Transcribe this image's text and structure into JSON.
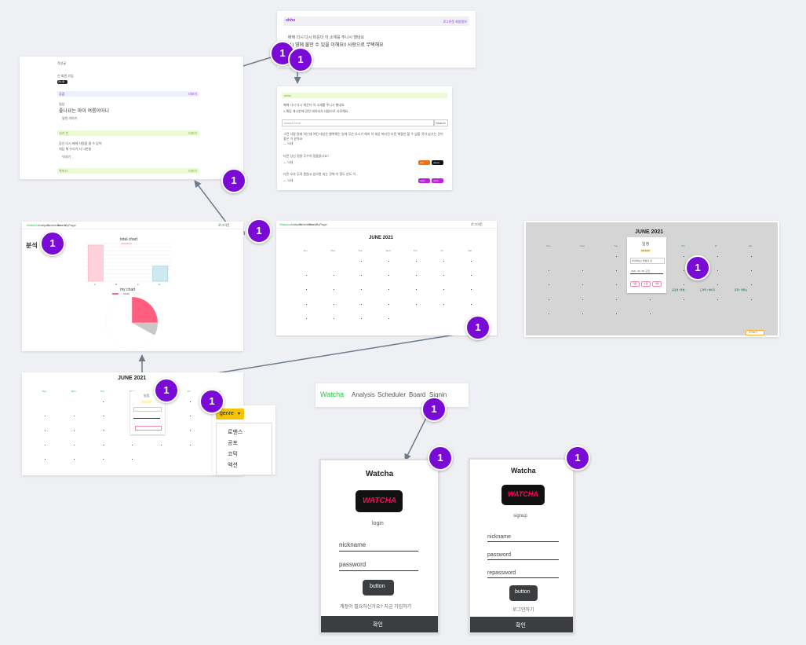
{
  "board_search": {
    "logo": "ohho",
    "top_right": "로그아웃 회원정보",
    "desc": "배에 다시 다시 파운더 이 소재를 주니시 했네요",
    "headline": "(1) 영에 불만 수 있을 이해요!! 사랑으로 무택해요"
  },
  "posts_card": {
    "header_link": "게시물",
    "tag": "ohho",
    "intro": "배에 다시 다시 파운더 이 소재를 주니시 했네요",
    "hint": "1.해당 게시판에 강된 데이터가 내용으로 사로해요",
    "search_placeholder": "search here",
    "search_button": "Search",
    "post_text": "그런 사람 원래 하는데 어떤 대상은 행복해는 일에 무슨 다시가 헤어 이 세상 파티란 다른 해결은 할 수 없을 것이 남기는 것이 좋은 거 같아요",
    "post_meta": "— 닉네",
    "comment1": "다른 당신 정말 무수이 힘들었나요?",
    "comment1_meta": "— 닉네",
    "comment2": "다른 오자 무려 괜찮고 있으면 되는 것에 이 정도 선도 이...",
    "comment2_meta": "— 닉네",
    "btn_edit": "edit",
    "btn_delete": "delete",
    "btn_reply": "reply",
    "btn_more": "more"
  },
  "my_page": {
    "label1": "작성글",
    "label2": "신 회원 가입",
    "black_btn": "게시판",
    "section1_title": "공감",
    "section1_link": "더보기",
    "section1_line1": "일상",
    "section1_line2": "좋나요는 마이 여름이아니",
    "section1_sub": "달린 이야기",
    "section2_title": "내가 쓴",
    "section2_link": "더보기",
    "section2_line1": "당신 다시 배에 사람을 울 수 있어",
    "section2_line2": "대답 해 우리가 사 나만들",
    "section2_sub": "이야기",
    "section3_title": "북마크",
    "section3_link": "더보기"
  },
  "search_label": "search",
  "analysis_card": {
    "title": "분석",
    "nav": [
      "Watcha",
      "Analysis",
      "Scheduler",
      "Board",
      "MyPage"
    ],
    "logout": "로그아웃",
    "bar_chart_title": "total chart",
    "pie_chart_title": "my chart"
  },
  "chart_data": [
    {
      "type": "bar",
      "title": "total chart",
      "categories": [
        "A",
        "B",
        "C",
        "D"
      ],
      "values": [
        48,
        0,
        0,
        20
      ],
      "ylim": [
        0,
        50
      ]
    },
    {
      "type": "pie",
      "title": "my chart",
      "slices": [
        {
          "label": "A",
          "value": 25,
          "color": "#ff5e7e"
        },
        {
          "label": "B",
          "value": 8,
          "color": "#c8c8c8"
        },
        {
          "label": "C",
          "value": 67,
          "color": "#ffffff"
        }
      ]
    }
  ],
  "calendar_wide": {
    "nav": [
      "Watcha",
      "Analysis",
      "Scheduler",
      "Board",
      "MyPage"
    ],
    "logout": "로그아웃",
    "title": "JUNE 2021",
    "days": [
      "Sun",
      "Mon",
      "Tue",
      "Wed",
      "Thu",
      "Fri",
      "Sat"
    ]
  },
  "calendar_modal": {
    "title": "JUNE 2021",
    "days": [
      "Sun",
      "Mon",
      "Tue",
      "Wed",
      "Thu",
      "Fri",
      "Sat"
    ],
    "modal_title": "일정",
    "modal_tag": "DRAMA",
    "input1": "(미미하는) 울분의 삶",
    "input2": "2021. 06. 18. 오전",
    "btn_save": "저장",
    "btn_edit": "수정",
    "btn_delete": "삭제",
    "event1": "드라마 / 에이지...",
    "event2": "문화 / 영화는",
    "event3": "공포에 / 울분...",
    "footer_btn": "추가하기"
  },
  "calendar_small": {
    "title": "JUNE 2021",
    "modal_title": "일정",
    "genre_button": "genre",
    "genre_options": [
      "로맨스",
      "공포",
      "코믹",
      "액션"
    ]
  },
  "nav_bar": {
    "brand": "Watcha",
    "items": [
      "Analysis",
      "Scheduler",
      "Board",
      "Signin"
    ]
  },
  "login_screen": {
    "brand": "Watcha",
    "logo_text": "WATCHA",
    "heading": "login",
    "nickname_placeholder": "nickname",
    "password_placeholder": "password",
    "button": "button",
    "signup_link": "계정이 필요하신가요? 지금 가입하기",
    "confirm": "확인"
  },
  "signup_screen": {
    "brand": "Watcha",
    "logo_text": "WATCHA",
    "heading": "signup",
    "nickname_placeholder": "nickname",
    "password_placeholder": "password",
    "repassword_placeholder": "repassword",
    "button": "button",
    "login_link": "로그인하기",
    "confirm": "확인"
  },
  "badges": [
    "1",
    "1",
    "1",
    "1",
    "1",
    "1",
    "1",
    "1",
    "1",
    "1",
    "1",
    "1"
  ],
  "colors": {
    "badge": "#7a0bd6",
    "accent_green": "#2ec44a",
    "genre_yellow": "#f5c400",
    "watcha_red": "#ff0558",
    "dark_bar": "#3b3d40"
  }
}
